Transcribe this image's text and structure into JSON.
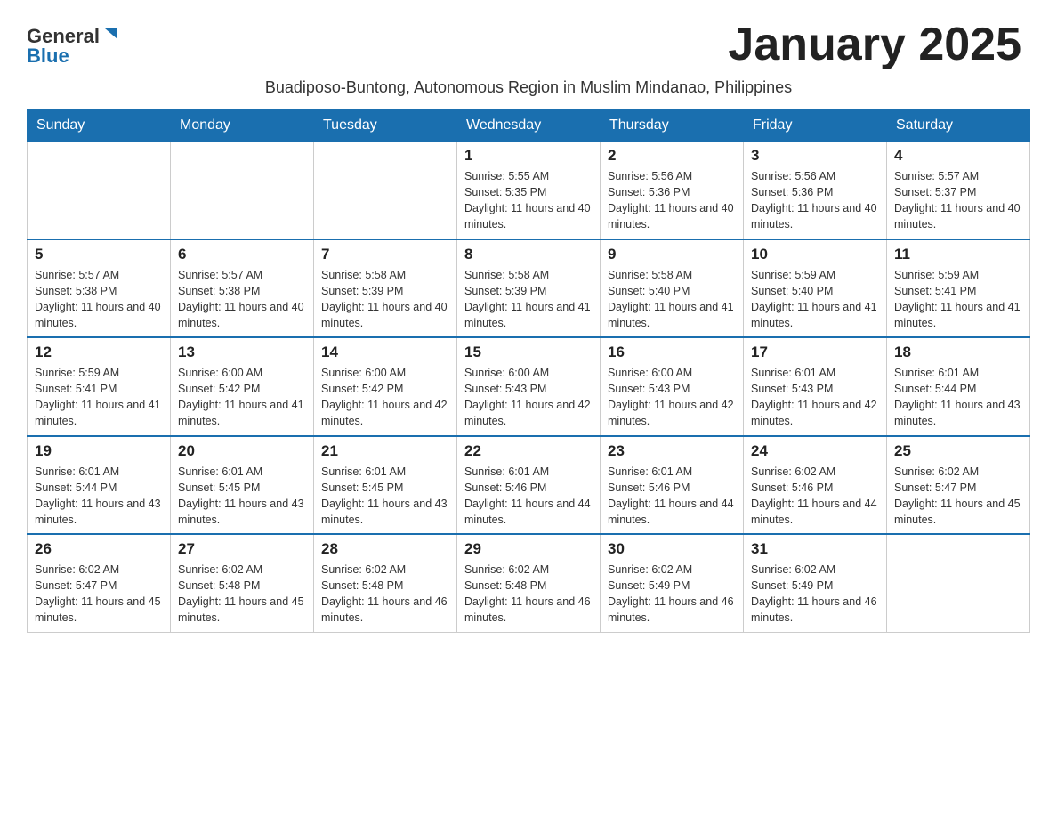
{
  "header": {
    "logo_line1": "General",
    "logo_line2": "Blue",
    "month_title": "January 2025",
    "subtitle": "Buadiposo-Buntong, Autonomous Region in Muslim Mindanao, Philippines"
  },
  "days_of_week": [
    "Sunday",
    "Monday",
    "Tuesday",
    "Wednesday",
    "Thursday",
    "Friday",
    "Saturday"
  ],
  "weeks": [
    [
      {
        "day": "",
        "info": ""
      },
      {
        "day": "",
        "info": ""
      },
      {
        "day": "",
        "info": ""
      },
      {
        "day": "1",
        "info": "Sunrise: 5:55 AM\nSunset: 5:35 PM\nDaylight: 11 hours and 40 minutes."
      },
      {
        "day": "2",
        "info": "Sunrise: 5:56 AM\nSunset: 5:36 PM\nDaylight: 11 hours and 40 minutes."
      },
      {
        "day": "3",
        "info": "Sunrise: 5:56 AM\nSunset: 5:36 PM\nDaylight: 11 hours and 40 minutes."
      },
      {
        "day": "4",
        "info": "Sunrise: 5:57 AM\nSunset: 5:37 PM\nDaylight: 11 hours and 40 minutes."
      }
    ],
    [
      {
        "day": "5",
        "info": "Sunrise: 5:57 AM\nSunset: 5:38 PM\nDaylight: 11 hours and 40 minutes."
      },
      {
        "day": "6",
        "info": "Sunrise: 5:57 AM\nSunset: 5:38 PM\nDaylight: 11 hours and 40 minutes."
      },
      {
        "day": "7",
        "info": "Sunrise: 5:58 AM\nSunset: 5:39 PM\nDaylight: 11 hours and 40 minutes."
      },
      {
        "day": "8",
        "info": "Sunrise: 5:58 AM\nSunset: 5:39 PM\nDaylight: 11 hours and 41 minutes."
      },
      {
        "day": "9",
        "info": "Sunrise: 5:58 AM\nSunset: 5:40 PM\nDaylight: 11 hours and 41 minutes."
      },
      {
        "day": "10",
        "info": "Sunrise: 5:59 AM\nSunset: 5:40 PM\nDaylight: 11 hours and 41 minutes."
      },
      {
        "day": "11",
        "info": "Sunrise: 5:59 AM\nSunset: 5:41 PM\nDaylight: 11 hours and 41 minutes."
      }
    ],
    [
      {
        "day": "12",
        "info": "Sunrise: 5:59 AM\nSunset: 5:41 PM\nDaylight: 11 hours and 41 minutes."
      },
      {
        "day": "13",
        "info": "Sunrise: 6:00 AM\nSunset: 5:42 PM\nDaylight: 11 hours and 41 minutes."
      },
      {
        "day": "14",
        "info": "Sunrise: 6:00 AM\nSunset: 5:42 PM\nDaylight: 11 hours and 42 minutes."
      },
      {
        "day": "15",
        "info": "Sunrise: 6:00 AM\nSunset: 5:43 PM\nDaylight: 11 hours and 42 minutes."
      },
      {
        "day": "16",
        "info": "Sunrise: 6:00 AM\nSunset: 5:43 PM\nDaylight: 11 hours and 42 minutes."
      },
      {
        "day": "17",
        "info": "Sunrise: 6:01 AM\nSunset: 5:43 PM\nDaylight: 11 hours and 42 minutes."
      },
      {
        "day": "18",
        "info": "Sunrise: 6:01 AM\nSunset: 5:44 PM\nDaylight: 11 hours and 43 minutes."
      }
    ],
    [
      {
        "day": "19",
        "info": "Sunrise: 6:01 AM\nSunset: 5:44 PM\nDaylight: 11 hours and 43 minutes."
      },
      {
        "day": "20",
        "info": "Sunrise: 6:01 AM\nSunset: 5:45 PM\nDaylight: 11 hours and 43 minutes."
      },
      {
        "day": "21",
        "info": "Sunrise: 6:01 AM\nSunset: 5:45 PM\nDaylight: 11 hours and 43 minutes."
      },
      {
        "day": "22",
        "info": "Sunrise: 6:01 AM\nSunset: 5:46 PM\nDaylight: 11 hours and 44 minutes."
      },
      {
        "day": "23",
        "info": "Sunrise: 6:01 AM\nSunset: 5:46 PM\nDaylight: 11 hours and 44 minutes."
      },
      {
        "day": "24",
        "info": "Sunrise: 6:02 AM\nSunset: 5:46 PM\nDaylight: 11 hours and 44 minutes."
      },
      {
        "day": "25",
        "info": "Sunrise: 6:02 AM\nSunset: 5:47 PM\nDaylight: 11 hours and 45 minutes."
      }
    ],
    [
      {
        "day": "26",
        "info": "Sunrise: 6:02 AM\nSunset: 5:47 PM\nDaylight: 11 hours and 45 minutes."
      },
      {
        "day": "27",
        "info": "Sunrise: 6:02 AM\nSunset: 5:48 PM\nDaylight: 11 hours and 45 minutes."
      },
      {
        "day": "28",
        "info": "Sunrise: 6:02 AM\nSunset: 5:48 PM\nDaylight: 11 hours and 46 minutes."
      },
      {
        "day": "29",
        "info": "Sunrise: 6:02 AM\nSunset: 5:48 PM\nDaylight: 11 hours and 46 minutes."
      },
      {
        "day": "30",
        "info": "Sunrise: 6:02 AM\nSunset: 5:49 PM\nDaylight: 11 hours and 46 minutes."
      },
      {
        "day": "31",
        "info": "Sunrise: 6:02 AM\nSunset: 5:49 PM\nDaylight: 11 hours and 46 minutes."
      },
      {
        "day": "",
        "info": ""
      }
    ]
  ]
}
